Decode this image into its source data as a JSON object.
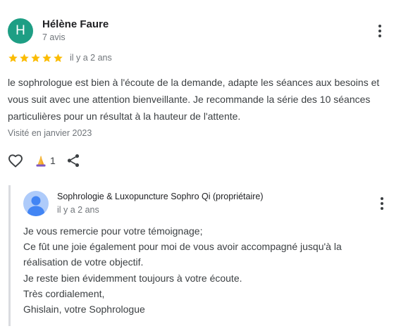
{
  "review": {
    "avatar_initial": "H",
    "avatar_color": "#1e9e84",
    "author_name": "Hélène Faure",
    "author_meta": "7 avis",
    "rating": 5,
    "rating_max": 5,
    "star_color": "#fbbc04",
    "date": "il y a 2 ans",
    "text": "le sophrologue est bien à l'écoute de la demande, adapte les séances aux besoins et vous suit avec une attention bienveillante. Je recommande la série des 10 séances particulières pour un résultat à la hauteur de l'attente.",
    "visited": "Visité en janvier 2023",
    "actions": {
      "like_icon": "heart-outline-icon",
      "reaction_icon": "praying-hands-emoji",
      "reaction_count": "1",
      "share_icon": "share-icon"
    },
    "more_icon": "more-vert-icon"
  },
  "owner_reply": {
    "owner_name": "Sophrologie & Luxopuncture Sophro Qi (propriétaire)",
    "date": "il y a 2 ans",
    "avatar_icon": "default-person-icon",
    "avatar_color": "#aecbfa",
    "lines": [
      "Je vous remercie pour votre témoignage;",
      "Ce fût une joie également pour moi de vous avoir accompagné jusqu'à la",
      "réalisation de votre objectif.",
      "Je reste bien évidemment toujours à votre écoute.",
      "Très cordialement,",
      "Ghislain, votre Sophrologue"
    ],
    "more_icon": "more-vert-icon"
  }
}
